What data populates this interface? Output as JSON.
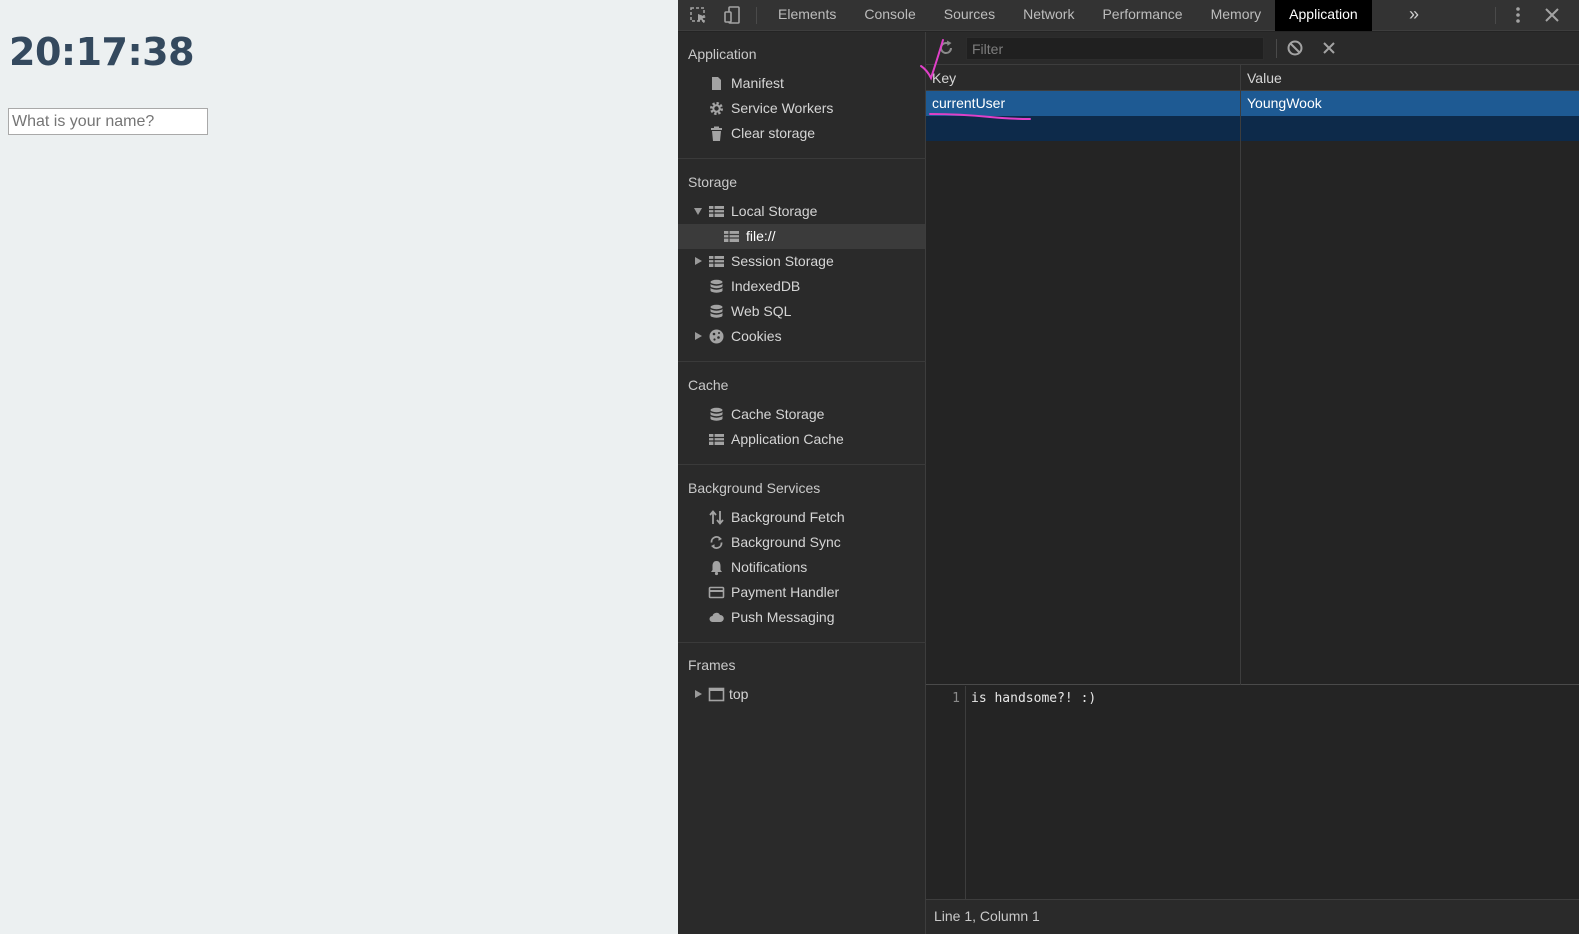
{
  "page": {
    "clock": "20:17:38",
    "name_placeholder": "What is your name?"
  },
  "devtools": {
    "tabs": [
      {
        "label": "Elements"
      },
      {
        "label": "Console"
      },
      {
        "label": "Sources"
      },
      {
        "label": "Network"
      },
      {
        "label": "Performance"
      },
      {
        "label": "Memory"
      },
      {
        "label": "Application",
        "active": true
      }
    ],
    "more_tabs_glyph": "»",
    "sidebar": {
      "sections": {
        "application": {
          "title": "Application",
          "items": [
            {
              "label": "Manifest",
              "icon": "document-icon"
            },
            {
              "label": "Service Workers",
              "icon": "gear-icon"
            },
            {
              "label": "Clear storage",
              "icon": "trash-icon"
            }
          ]
        },
        "storage": {
          "title": "Storage",
          "items": [
            {
              "label": "Local Storage",
              "icon": "table-icon",
              "expanded": true
            },
            {
              "label": "file://",
              "icon": "table-icon",
              "selected": true
            },
            {
              "label": "Session Storage",
              "icon": "table-icon",
              "expanded": false
            },
            {
              "label": "IndexedDB",
              "icon": "database-icon"
            },
            {
              "label": "Web SQL",
              "icon": "database-icon"
            },
            {
              "label": "Cookies",
              "icon": "cookie-icon",
              "expanded": false
            }
          ]
        },
        "cache": {
          "title": "Cache",
          "items": [
            {
              "label": "Cache Storage",
              "icon": "database-icon"
            },
            {
              "label": "Application Cache",
              "icon": "table-icon"
            }
          ]
        },
        "background_services": {
          "title": "Background Services",
          "items": [
            {
              "label": "Background Fetch",
              "icon": "arrows-updown-icon"
            },
            {
              "label": "Background Sync",
              "icon": "sync-icon"
            },
            {
              "label": "Notifications",
              "icon": "bell-icon"
            },
            {
              "label": "Payment Handler",
              "icon": "card-icon"
            },
            {
              "label": "Push Messaging",
              "icon": "cloud-icon"
            }
          ]
        },
        "frames": {
          "title": "Frames",
          "items": [
            {
              "label": "top",
              "icon": "frame-icon",
              "expanded": false
            }
          ]
        }
      }
    },
    "storage_view": {
      "filter_placeholder": "Filter",
      "columns": {
        "key": "Key",
        "value": "Value"
      },
      "rows": [
        {
          "key": "currentUser",
          "value": "YoungWook",
          "selected": true
        }
      ],
      "editor": {
        "line_number": "1",
        "content": "is handsome?! :)"
      },
      "status": "Line 1, Column 1"
    },
    "colors": {
      "selected_row": "#1e5a93",
      "active_tab": "#000000",
      "annotation": "#e040c8"
    }
  }
}
